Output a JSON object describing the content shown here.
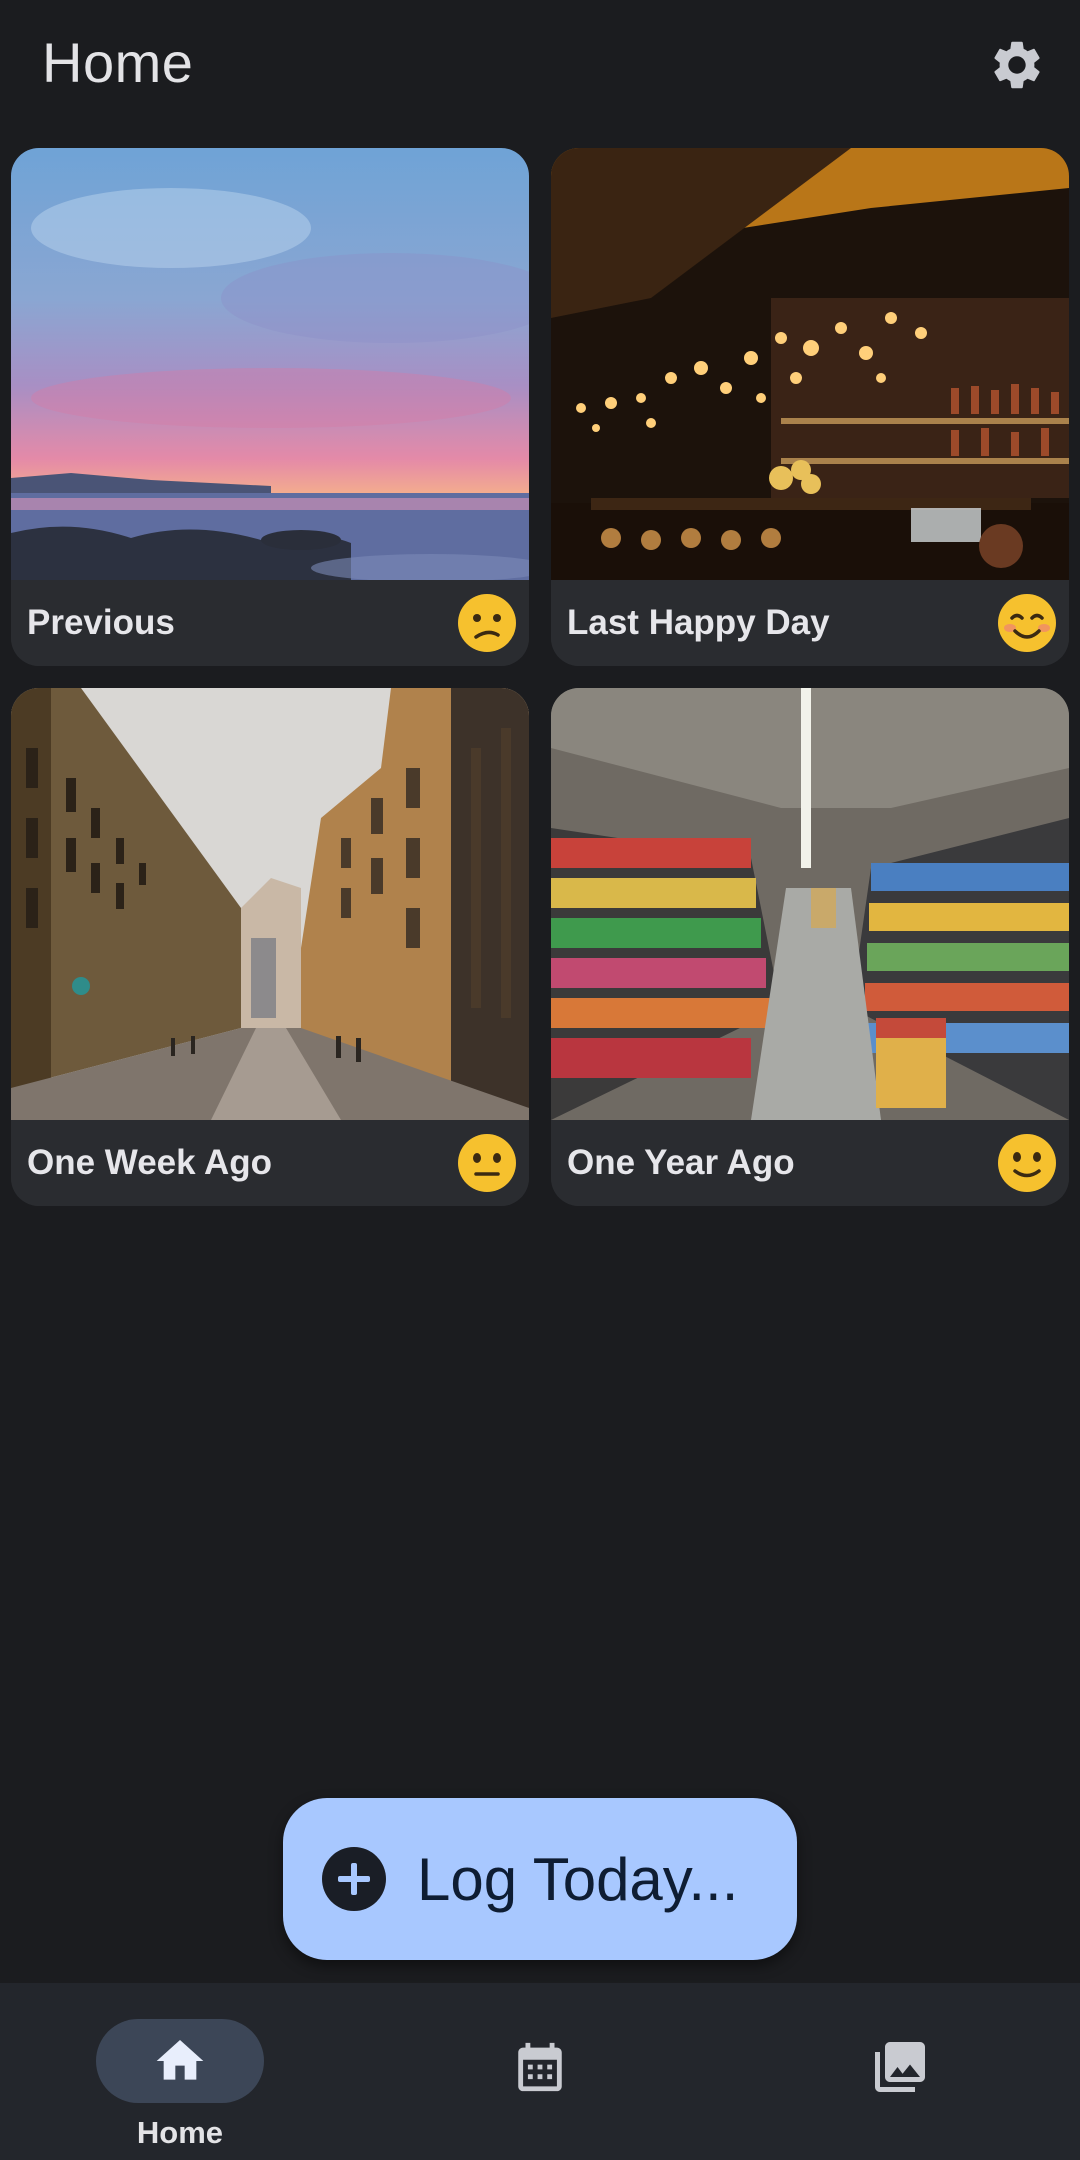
{
  "header": {
    "title": "Home",
    "settings_icon": "gear-icon"
  },
  "cards": [
    {
      "label": "Previous",
      "mood_icon": "confused-face-icon"
    },
    {
      "label": "Last Happy Day",
      "mood_icon": "smiling-blush-face-icon"
    },
    {
      "label": "One Week Ago",
      "mood_icon": "neutral-face-icon"
    },
    {
      "label": "One Year Ago",
      "mood_icon": "slight-smile-face-icon"
    }
  ],
  "fab": {
    "label": "Log Today...",
    "icon": "add-circle-icon",
    "color": "#a8c8ff"
  },
  "bottom_nav": {
    "items": [
      {
        "label": "Home",
        "icon": "home-icon",
        "selected": true
      },
      {
        "label": "",
        "icon": "calendar-icon",
        "selected": false
      },
      {
        "label": "",
        "icon": "gallery-icon",
        "selected": false
      }
    ]
  },
  "colors": {
    "background": "#1b1c1f",
    "card": "#2a2c30",
    "nav_bar": "#23262c",
    "nav_pill": "#3c4657",
    "emoji": "#f6c12e"
  }
}
